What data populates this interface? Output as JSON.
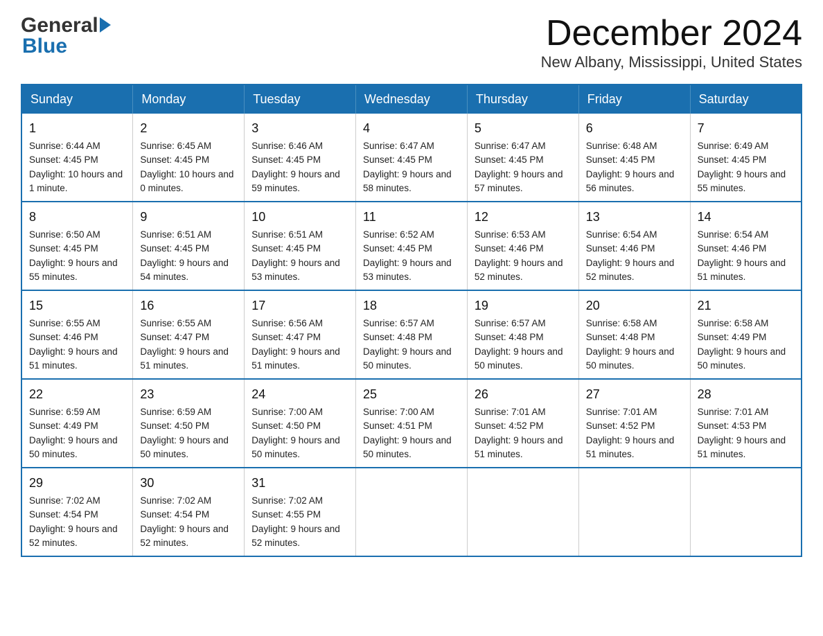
{
  "header": {
    "month_title": "December 2024",
    "location": "New Albany, Mississippi, United States"
  },
  "logo": {
    "part1": "General",
    "part2": "Blue"
  },
  "days_of_week": [
    "Sunday",
    "Monday",
    "Tuesday",
    "Wednesday",
    "Thursday",
    "Friday",
    "Saturday"
  ],
  "weeks": [
    [
      {
        "day": "1",
        "sunrise": "6:44 AM",
        "sunset": "4:45 PM",
        "daylight": "10 hours and 1 minute."
      },
      {
        "day": "2",
        "sunrise": "6:45 AM",
        "sunset": "4:45 PM",
        "daylight": "10 hours and 0 minutes."
      },
      {
        "day": "3",
        "sunrise": "6:46 AM",
        "sunset": "4:45 PM",
        "daylight": "9 hours and 59 minutes."
      },
      {
        "day": "4",
        "sunrise": "6:47 AM",
        "sunset": "4:45 PM",
        "daylight": "9 hours and 58 minutes."
      },
      {
        "day": "5",
        "sunrise": "6:47 AM",
        "sunset": "4:45 PM",
        "daylight": "9 hours and 57 minutes."
      },
      {
        "day": "6",
        "sunrise": "6:48 AM",
        "sunset": "4:45 PM",
        "daylight": "9 hours and 56 minutes."
      },
      {
        "day": "7",
        "sunrise": "6:49 AM",
        "sunset": "4:45 PM",
        "daylight": "9 hours and 55 minutes."
      }
    ],
    [
      {
        "day": "8",
        "sunrise": "6:50 AM",
        "sunset": "4:45 PM",
        "daylight": "9 hours and 55 minutes."
      },
      {
        "day": "9",
        "sunrise": "6:51 AM",
        "sunset": "4:45 PM",
        "daylight": "9 hours and 54 minutes."
      },
      {
        "day": "10",
        "sunrise": "6:51 AM",
        "sunset": "4:45 PM",
        "daylight": "9 hours and 53 minutes."
      },
      {
        "day": "11",
        "sunrise": "6:52 AM",
        "sunset": "4:45 PM",
        "daylight": "9 hours and 53 minutes."
      },
      {
        "day": "12",
        "sunrise": "6:53 AM",
        "sunset": "4:46 PM",
        "daylight": "9 hours and 52 minutes."
      },
      {
        "day": "13",
        "sunrise": "6:54 AM",
        "sunset": "4:46 PM",
        "daylight": "9 hours and 52 minutes."
      },
      {
        "day": "14",
        "sunrise": "6:54 AM",
        "sunset": "4:46 PM",
        "daylight": "9 hours and 51 minutes."
      }
    ],
    [
      {
        "day": "15",
        "sunrise": "6:55 AM",
        "sunset": "4:46 PM",
        "daylight": "9 hours and 51 minutes."
      },
      {
        "day": "16",
        "sunrise": "6:55 AM",
        "sunset": "4:47 PM",
        "daylight": "9 hours and 51 minutes."
      },
      {
        "day": "17",
        "sunrise": "6:56 AM",
        "sunset": "4:47 PM",
        "daylight": "9 hours and 51 minutes."
      },
      {
        "day": "18",
        "sunrise": "6:57 AM",
        "sunset": "4:48 PM",
        "daylight": "9 hours and 50 minutes."
      },
      {
        "day": "19",
        "sunrise": "6:57 AM",
        "sunset": "4:48 PM",
        "daylight": "9 hours and 50 minutes."
      },
      {
        "day": "20",
        "sunrise": "6:58 AM",
        "sunset": "4:48 PM",
        "daylight": "9 hours and 50 minutes."
      },
      {
        "day": "21",
        "sunrise": "6:58 AM",
        "sunset": "4:49 PM",
        "daylight": "9 hours and 50 minutes."
      }
    ],
    [
      {
        "day": "22",
        "sunrise": "6:59 AM",
        "sunset": "4:49 PM",
        "daylight": "9 hours and 50 minutes."
      },
      {
        "day": "23",
        "sunrise": "6:59 AM",
        "sunset": "4:50 PM",
        "daylight": "9 hours and 50 minutes."
      },
      {
        "day": "24",
        "sunrise": "7:00 AM",
        "sunset": "4:50 PM",
        "daylight": "9 hours and 50 minutes."
      },
      {
        "day": "25",
        "sunrise": "7:00 AM",
        "sunset": "4:51 PM",
        "daylight": "9 hours and 50 minutes."
      },
      {
        "day": "26",
        "sunrise": "7:01 AM",
        "sunset": "4:52 PM",
        "daylight": "9 hours and 51 minutes."
      },
      {
        "day": "27",
        "sunrise": "7:01 AM",
        "sunset": "4:52 PM",
        "daylight": "9 hours and 51 minutes."
      },
      {
        "day": "28",
        "sunrise": "7:01 AM",
        "sunset": "4:53 PM",
        "daylight": "9 hours and 51 minutes."
      }
    ],
    [
      {
        "day": "29",
        "sunrise": "7:02 AM",
        "sunset": "4:54 PM",
        "daylight": "9 hours and 52 minutes."
      },
      {
        "day": "30",
        "sunrise": "7:02 AM",
        "sunset": "4:54 PM",
        "daylight": "9 hours and 52 minutes."
      },
      {
        "day": "31",
        "sunrise": "7:02 AM",
        "sunset": "4:55 PM",
        "daylight": "9 hours and 52 minutes."
      },
      null,
      null,
      null,
      null
    ]
  ]
}
